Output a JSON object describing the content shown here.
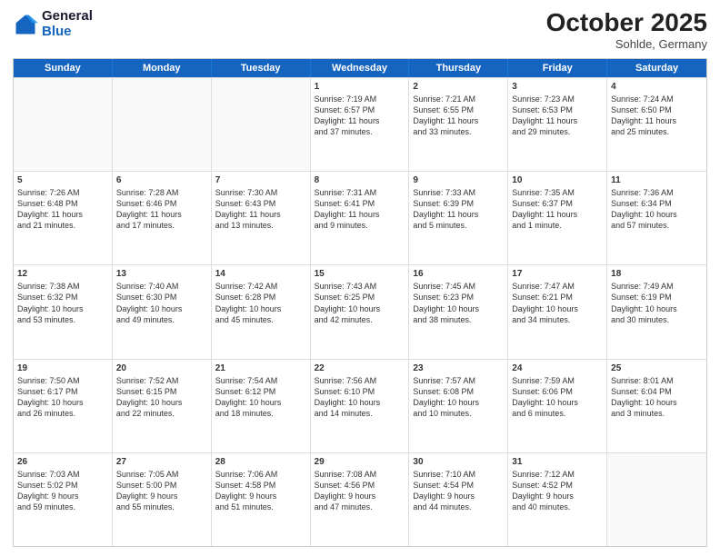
{
  "header": {
    "logo_general": "General",
    "logo_blue": "Blue",
    "month_title": "October 2025",
    "subtitle": "Sohlde, Germany"
  },
  "days_of_week": [
    "Sunday",
    "Monday",
    "Tuesday",
    "Wednesday",
    "Thursday",
    "Friday",
    "Saturday"
  ],
  "rows": [
    [
      {
        "day": "",
        "info": ""
      },
      {
        "day": "",
        "info": ""
      },
      {
        "day": "",
        "info": ""
      },
      {
        "day": "1",
        "info": "Sunrise: 7:19 AM\nSunset: 6:57 PM\nDaylight: 11 hours\nand 37 minutes."
      },
      {
        "day": "2",
        "info": "Sunrise: 7:21 AM\nSunset: 6:55 PM\nDaylight: 11 hours\nand 33 minutes."
      },
      {
        "day": "3",
        "info": "Sunrise: 7:23 AM\nSunset: 6:53 PM\nDaylight: 11 hours\nand 29 minutes."
      },
      {
        "day": "4",
        "info": "Sunrise: 7:24 AM\nSunset: 6:50 PM\nDaylight: 11 hours\nand 25 minutes."
      }
    ],
    [
      {
        "day": "5",
        "info": "Sunrise: 7:26 AM\nSunset: 6:48 PM\nDaylight: 11 hours\nand 21 minutes."
      },
      {
        "day": "6",
        "info": "Sunrise: 7:28 AM\nSunset: 6:46 PM\nDaylight: 11 hours\nand 17 minutes."
      },
      {
        "day": "7",
        "info": "Sunrise: 7:30 AM\nSunset: 6:43 PM\nDaylight: 11 hours\nand 13 minutes."
      },
      {
        "day": "8",
        "info": "Sunrise: 7:31 AM\nSunset: 6:41 PM\nDaylight: 11 hours\nand 9 minutes."
      },
      {
        "day": "9",
        "info": "Sunrise: 7:33 AM\nSunset: 6:39 PM\nDaylight: 11 hours\nand 5 minutes."
      },
      {
        "day": "10",
        "info": "Sunrise: 7:35 AM\nSunset: 6:37 PM\nDaylight: 11 hours\nand 1 minute."
      },
      {
        "day": "11",
        "info": "Sunrise: 7:36 AM\nSunset: 6:34 PM\nDaylight: 10 hours\nand 57 minutes."
      }
    ],
    [
      {
        "day": "12",
        "info": "Sunrise: 7:38 AM\nSunset: 6:32 PM\nDaylight: 10 hours\nand 53 minutes."
      },
      {
        "day": "13",
        "info": "Sunrise: 7:40 AM\nSunset: 6:30 PM\nDaylight: 10 hours\nand 49 minutes."
      },
      {
        "day": "14",
        "info": "Sunrise: 7:42 AM\nSunset: 6:28 PM\nDaylight: 10 hours\nand 45 minutes."
      },
      {
        "day": "15",
        "info": "Sunrise: 7:43 AM\nSunset: 6:25 PM\nDaylight: 10 hours\nand 42 minutes."
      },
      {
        "day": "16",
        "info": "Sunrise: 7:45 AM\nSunset: 6:23 PM\nDaylight: 10 hours\nand 38 minutes."
      },
      {
        "day": "17",
        "info": "Sunrise: 7:47 AM\nSunset: 6:21 PM\nDaylight: 10 hours\nand 34 minutes."
      },
      {
        "day": "18",
        "info": "Sunrise: 7:49 AM\nSunset: 6:19 PM\nDaylight: 10 hours\nand 30 minutes."
      }
    ],
    [
      {
        "day": "19",
        "info": "Sunrise: 7:50 AM\nSunset: 6:17 PM\nDaylight: 10 hours\nand 26 minutes."
      },
      {
        "day": "20",
        "info": "Sunrise: 7:52 AM\nSunset: 6:15 PM\nDaylight: 10 hours\nand 22 minutes."
      },
      {
        "day": "21",
        "info": "Sunrise: 7:54 AM\nSunset: 6:12 PM\nDaylight: 10 hours\nand 18 minutes."
      },
      {
        "day": "22",
        "info": "Sunrise: 7:56 AM\nSunset: 6:10 PM\nDaylight: 10 hours\nand 14 minutes."
      },
      {
        "day": "23",
        "info": "Sunrise: 7:57 AM\nSunset: 6:08 PM\nDaylight: 10 hours\nand 10 minutes."
      },
      {
        "day": "24",
        "info": "Sunrise: 7:59 AM\nSunset: 6:06 PM\nDaylight: 10 hours\nand 6 minutes."
      },
      {
        "day": "25",
        "info": "Sunrise: 8:01 AM\nSunset: 6:04 PM\nDaylight: 10 hours\nand 3 minutes."
      }
    ],
    [
      {
        "day": "26",
        "info": "Sunrise: 7:03 AM\nSunset: 5:02 PM\nDaylight: 9 hours\nand 59 minutes."
      },
      {
        "day": "27",
        "info": "Sunrise: 7:05 AM\nSunset: 5:00 PM\nDaylight: 9 hours\nand 55 minutes."
      },
      {
        "day": "28",
        "info": "Sunrise: 7:06 AM\nSunset: 4:58 PM\nDaylight: 9 hours\nand 51 minutes."
      },
      {
        "day": "29",
        "info": "Sunrise: 7:08 AM\nSunset: 4:56 PM\nDaylight: 9 hours\nand 47 minutes."
      },
      {
        "day": "30",
        "info": "Sunrise: 7:10 AM\nSunset: 4:54 PM\nDaylight: 9 hours\nand 44 minutes."
      },
      {
        "day": "31",
        "info": "Sunrise: 7:12 AM\nSunset: 4:52 PM\nDaylight: 9 hours\nand 40 minutes."
      },
      {
        "day": "",
        "info": ""
      }
    ]
  ]
}
